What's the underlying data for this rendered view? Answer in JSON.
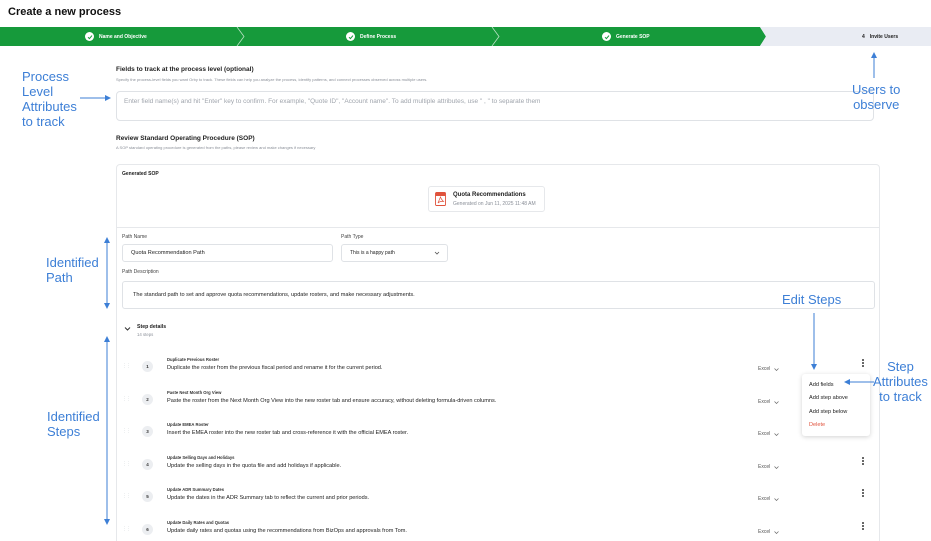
{
  "page": {
    "title": "Create a new process"
  },
  "stepper": {
    "steps": [
      {
        "label": "Name and Objective",
        "state": "done"
      },
      {
        "label": "Define Process",
        "state": "done"
      },
      {
        "label": "Generate SOP",
        "state": "done"
      },
      {
        "number": "4",
        "label": "Invite Users",
        "state": "current"
      }
    ],
    "done_color": "#169a3b",
    "todo_color": "#e9ecf3"
  },
  "fields_section": {
    "title": "Fields to track at the process level (optional)",
    "subtitle": "Specify the process-level fields you want Orby to track. These fields can help you analyze the process, identify patterns, and connect processes observed across multiple users.",
    "placeholder": "Enter field name(s) and hit \"Enter\" key to confirm. For example, \"Quote ID\", \"Account name\". To add multiple attributes, use \" , \" to separate them"
  },
  "sop_section": {
    "title": "Review Standard Operating Procedure (SOP)",
    "subtitle": "A SOP standard operating procedure is generated from the paths, please review and make changes if necessary",
    "card_title": "Generated SOP",
    "document": {
      "name": "Quota Recommendations",
      "generated": "Generated on Jun 11, 2025 11:48 AM"
    }
  },
  "path": {
    "name_label": "Path Name",
    "name_value": "Quota Recommendation Path",
    "type_label": "Path Type",
    "type_value": "This is a happy path",
    "desc_label": "Path Description",
    "desc_value": "The standard path to set and approve quota recommendations, update rosters, and make necessary adjustments."
  },
  "step_details": {
    "title": "Step details",
    "count": "14 steps",
    "steps": [
      {
        "num": "1",
        "title": "Duplicate Previous Roster",
        "desc": "Duplicate the roster from the previous fiscal period and rename it for the current period.",
        "app": "Excel"
      },
      {
        "num": "2",
        "title": "Paste Next Month Org View",
        "desc": "Paste the roster from the Next Month Org View into the new roster tab and ensure accuracy, without deleting formula-driven columns.",
        "app": "Excel"
      },
      {
        "num": "3",
        "title": "Update EMEA Roster",
        "desc": "Insert the EMEA roster into the new roster tab and cross-reference it with the official EMEA roster.",
        "app": "Excel"
      },
      {
        "num": "4",
        "title": "Update Selling Days and Holidays",
        "desc": "Update the selling days in the quota file and add holidays if applicable.",
        "app": "Excel"
      },
      {
        "num": "5",
        "title": "Update ADR Summary Dates",
        "desc": "Update the dates in the ADR Summary tab to reflect the current and prior periods.",
        "app": "Excel"
      },
      {
        "num": "6",
        "title": "Update Daily Rates and Quotas",
        "desc": "Update daily rates and quotas using the recommendations from BizOps and approvals from Tom.",
        "app": "Excel"
      }
    ]
  },
  "context_menu": {
    "items": [
      "Add fields",
      "Add step above",
      "Add step below",
      "Delete"
    ]
  },
  "annotations": {
    "process_attrs": [
      "Process",
      "Level",
      "Attributes",
      "to track"
    ],
    "users": [
      "Users to",
      "observe"
    ],
    "identified_path": [
      "Identified",
      "Path"
    ],
    "edit_steps": "Edit Steps",
    "step_attrs": [
      "Step",
      "Attributes",
      "to track"
    ],
    "identified_steps": [
      "Identified",
      "Steps"
    ],
    "color": "#3d7fd6"
  }
}
